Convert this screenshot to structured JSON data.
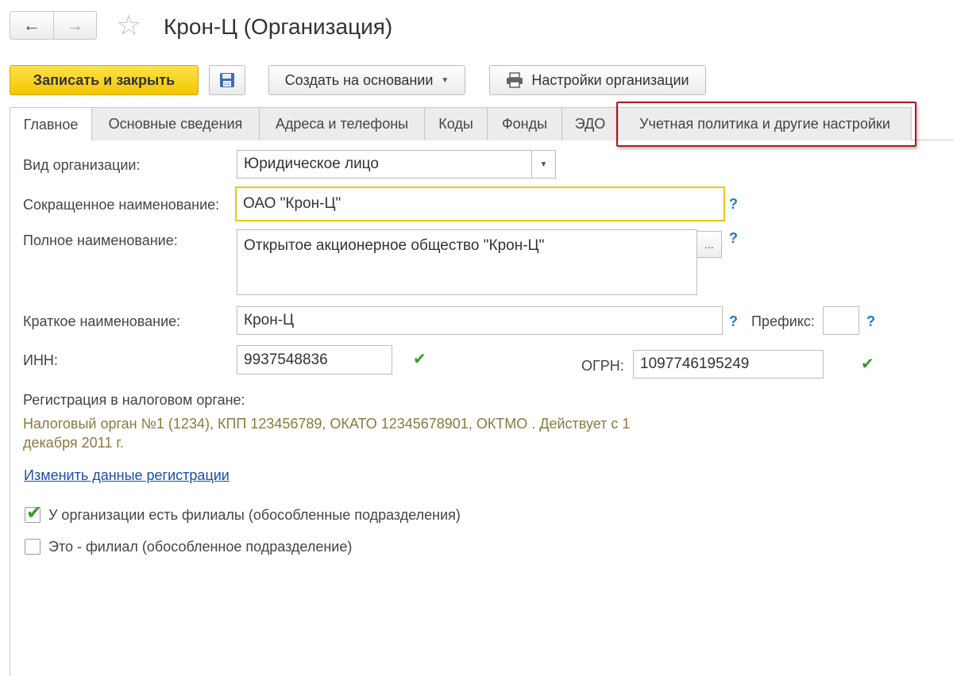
{
  "window": {
    "title": "Крон-Ц (Организация)",
    "back_icon": "←",
    "forward_icon": "→",
    "favorite_icon": "☆"
  },
  "toolbar": {
    "save_close_label": "Записать и закрыть",
    "save_icon": "floppy-disk",
    "create_based_label": "Создать на основании",
    "settings_label": "Настройки организации"
  },
  "tabs": [
    "Главное",
    "Основные сведения",
    "Адреса и телефоны",
    "Коды",
    "Фонды",
    "ЭДО",
    "Учетная политика и другие настройки"
  ],
  "form": {
    "org_type_label": "Вид организации:",
    "org_type_value": "Юридическое лицо",
    "short_name_label": "Сокращенное наименование:",
    "short_name_value": "ОАО \"Крон-Ц\"",
    "full_name_label": "Полное наименование:",
    "full_name_value": "Открытое акционерное общество \"Крон-Ц\"",
    "full_name_button": "...",
    "brief_name_label": "Краткое наименование:",
    "brief_name_value": "Крон-Ц",
    "prefix_label": "Префикс:",
    "prefix_value": "",
    "inn_label": "ИНН:",
    "inn_value": "9937548836",
    "ogrn_label": "ОГРН:",
    "ogrn_value": "1097746195249",
    "help_mark": "?",
    "valid_mark": "✔",
    "tax_reg_label": "Регистрация в налоговом органе:",
    "tax_reg_line1": "Налоговый орган №1 (1234), КПП 123456789, ОКАТО 12345678901, ОКТМО . Действует с 1",
    "tax_reg_line2": "декабря 2011 г.",
    "change_reg_link": "Изменить данные регистрации",
    "has_branches_label": "У организации есть филиалы (обособленные подразделения)",
    "has_branches_checked": true,
    "is_branch_label": "Это - филиал (обособленное подразделение)",
    "is_branch_checked": false
  },
  "colors": {
    "primary_button": "#f4c600",
    "highlight_border": "#b3151b",
    "focus_border": "#f2c411",
    "link": "#1a4ea8",
    "help": "#1d7bc2",
    "valid": "#3b9a2a",
    "tax_info_text": "#8a7a3c"
  }
}
